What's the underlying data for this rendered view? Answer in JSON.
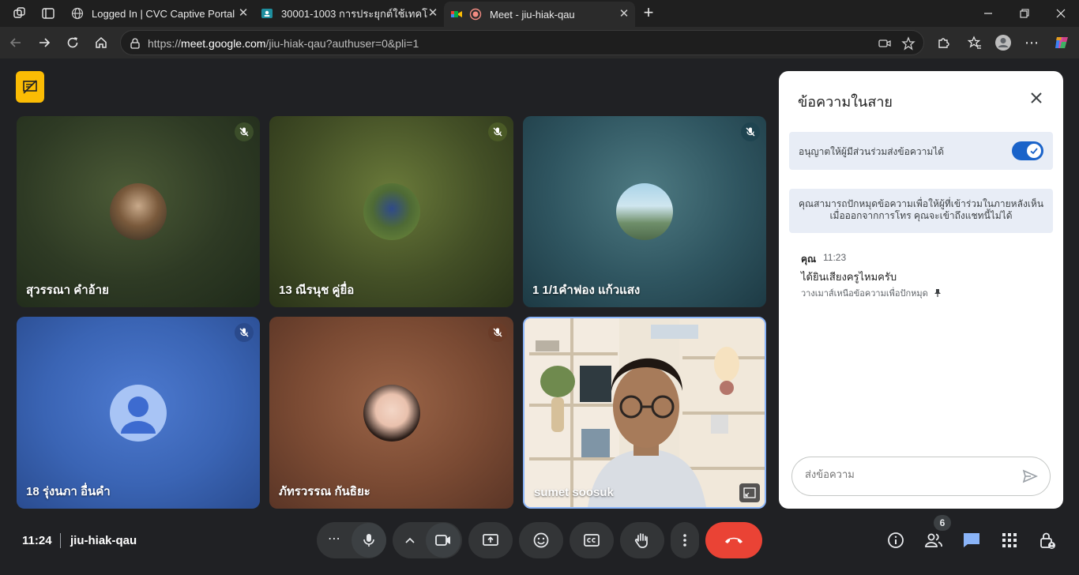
{
  "browser": {
    "tabs": [
      {
        "label": "Logged In | CVC Captive Portal"
      },
      {
        "label": "30001-1003 การประยุกต์ใช้เทคโนโลยีดิจิทัล"
      },
      {
        "label": "Meet - jiu-hiak-qau"
      }
    ],
    "url_prefix": "https://",
    "url_host": "meet.google.com",
    "url_path": "/jiu-hiak-qau?authuser=0&pli=1"
  },
  "participants": [
    {
      "name": "สุวรรณา คำอ้าย",
      "muted": true
    },
    {
      "name": "13 ณีรนุช คู่ยื่อ",
      "muted": true
    },
    {
      "name": "1 1/1คำฟอง แก้วแสง",
      "muted": true
    },
    {
      "name": "18 รุ่งนภา อื่นคำ",
      "muted": true
    },
    {
      "name": "ภัทรวรรณ กันธิยะ",
      "muted": true
    },
    {
      "name": "sumet soosuk",
      "muted": false
    }
  ],
  "chat": {
    "title": "ข้อความในสาย",
    "allow_label": "อนุญาตให้ผู้มีส่วนร่วมส่งข้อความได้",
    "allow_enabled": true,
    "pin_note": "คุณสามารถปักหมุดข้อความเพื่อให้ผู้ที่เข้าร่วมในภายหลังเห็น เมื่อออกจากการโทร คุณจะเข้าถึงแชทนี้ไม่ได้",
    "messages": [
      {
        "sender": "คุณ",
        "time": "11:23",
        "text": "ได้ยินเสียงครูไหมครับ",
        "hint": "วางเมาส์เหนือข้อความเพื่อปักหมุด"
      }
    ],
    "input_placeholder": "ส่งข้อความ"
  },
  "meeting": {
    "time": "11:24",
    "code": "jiu-hiak-qau",
    "people_count": "6"
  },
  "colors": {
    "end_call": "#ea4335",
    "chat_active": "#8ab4f8",
    "toggle_on": "#1a63c9",
    "host_badge": "#fbbc04"
  }
}
